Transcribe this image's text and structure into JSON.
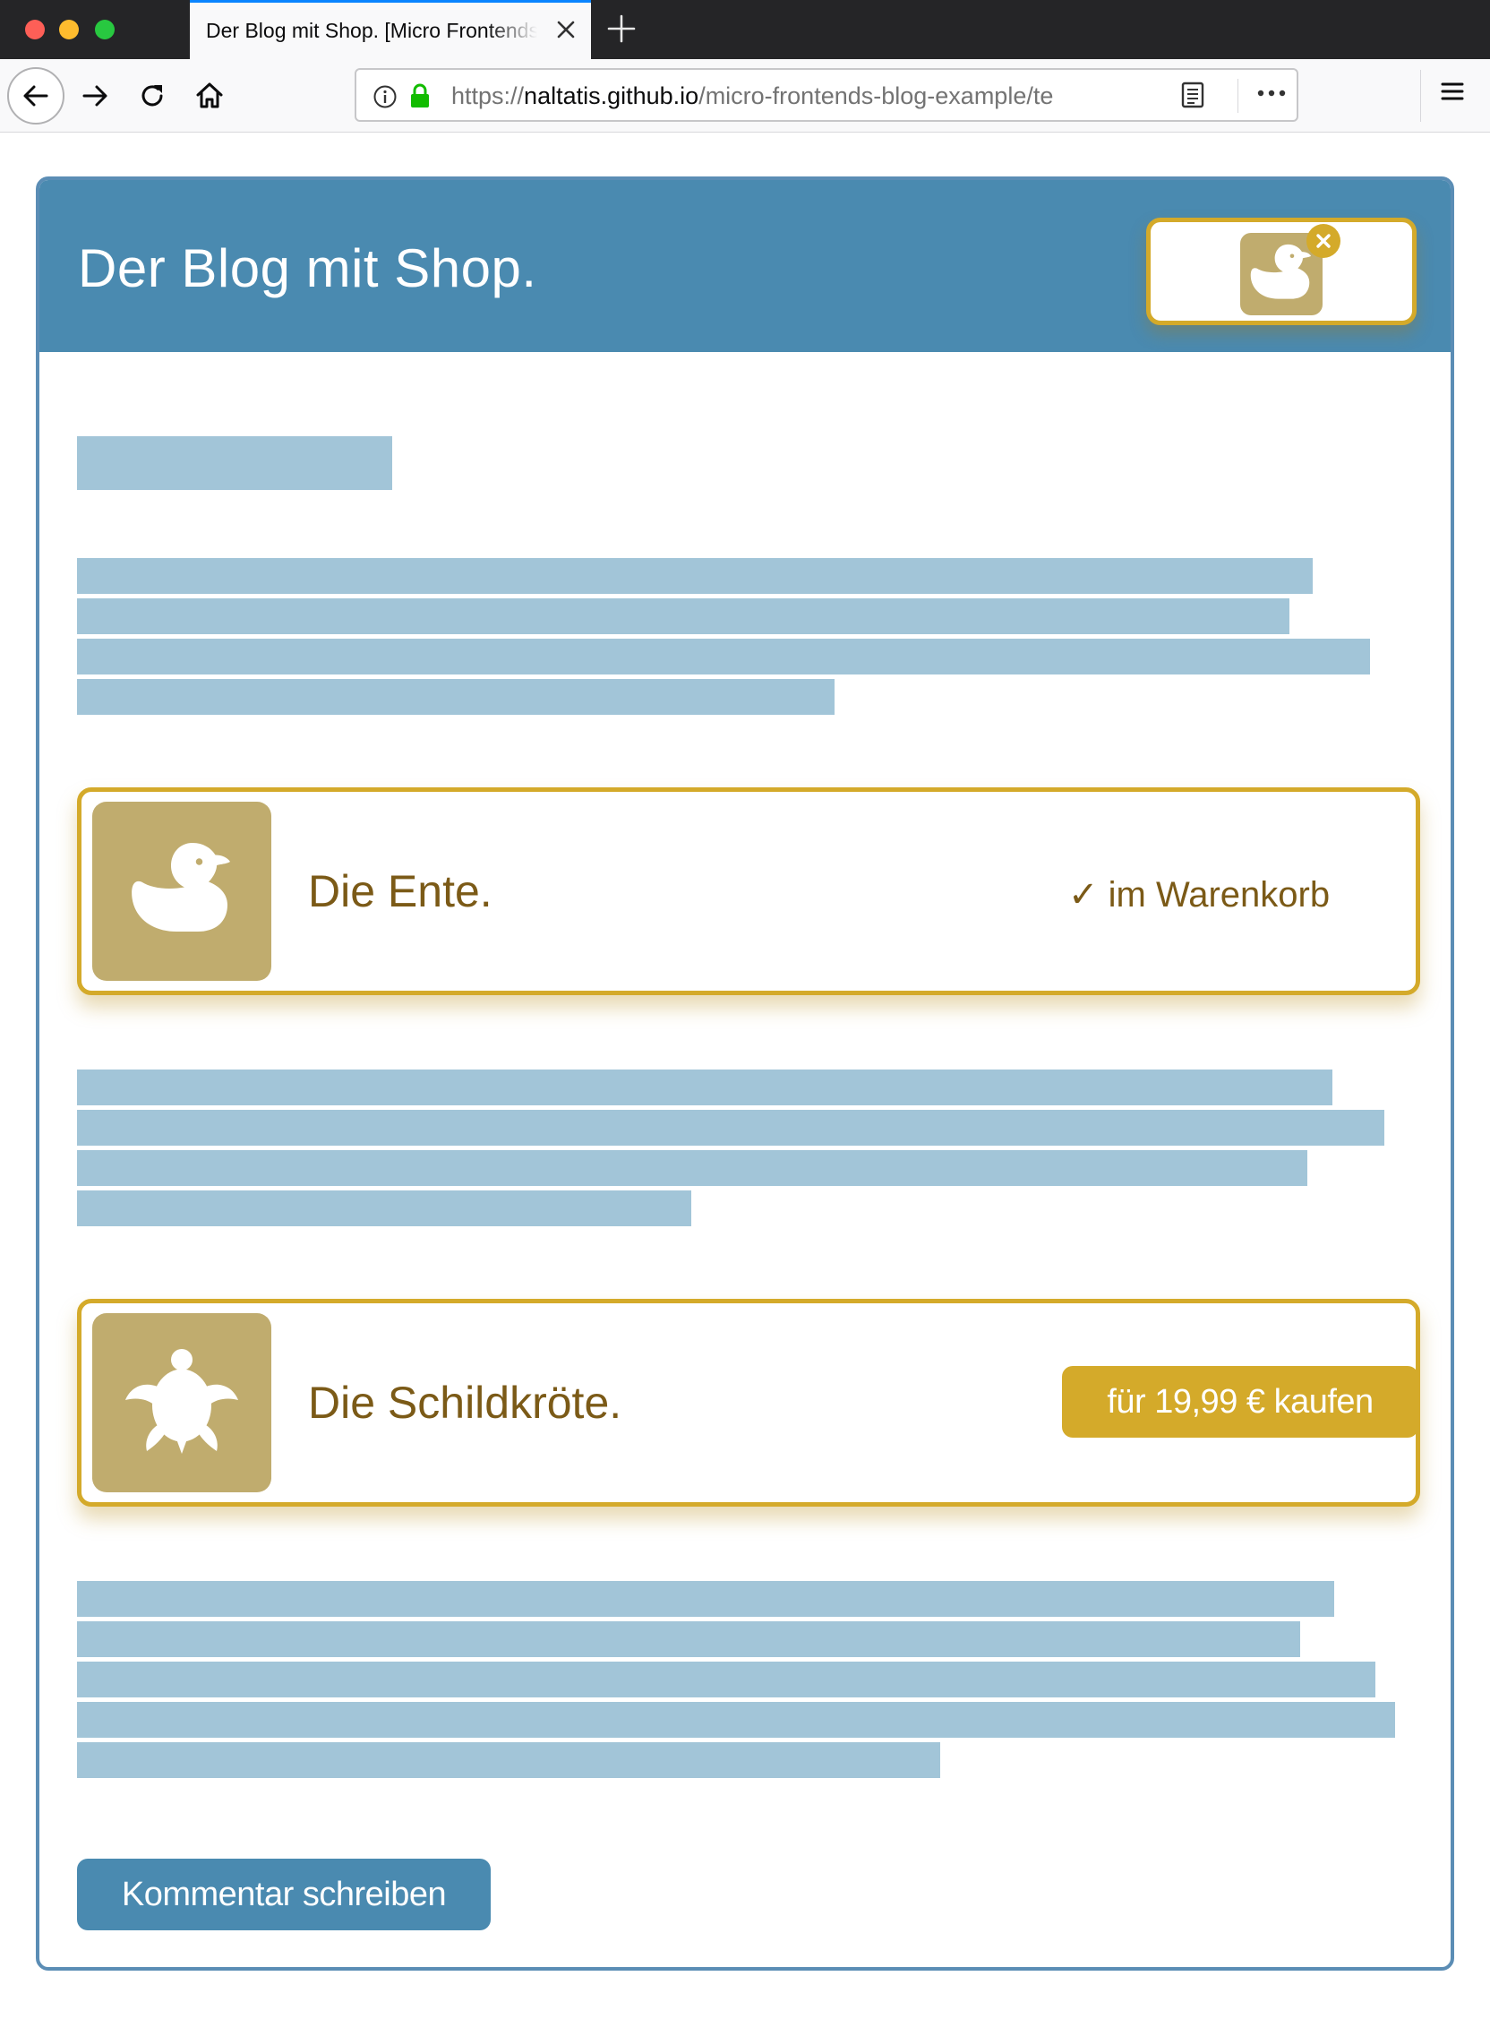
{
  "browser": {
    "tab_title": "Der Blog mit Shop. [Micro Frontends",
    "tab_close_icon": "close-icon",
    "new_tab_icon": "plus-icon",
    "url_scheme": "https://",
    "url_host": "naltatis.github.io",
    "url_path": "/micro-frontends-blog-example/te",
    "colors": {
      "titlebar": "#252527",
      "tab_accent": "#0a84ff",
      "lock": "#12bc00"
    }
  },
  "header": {
    "title": "Der Blog mit Shop.",
    "basket": {
      "items": [
        {
          "name": "Ente",
          "icon": "duck-icon"
        }
      ],
      "remove_label": "×"
    }
  },
  "products": [
    {
      "name": "Die Ente.",
      "icon": "duck-icon",
      "status": "im Warenkorb",
      "status_mark": "✓",
      "in_basket": true
    },
    {
      "name": "Die Schildkröte.",
      "icon": "turtle-icon",
      "buy_label": "für 19,99 € kaufen",
      "in_basket": false
    }
  ],
  "actions": {
    "comment_label": "Kommentar schreiben"
  },
  "colors": {
    "brand_blue": "#4a8ab0",
    "placeholder": "#a2c5d8",
    "gold": "#d4aa2a",
    "product_bg": "#c0ac6e",
    "product_text": "#7b5a17"
  }
}
